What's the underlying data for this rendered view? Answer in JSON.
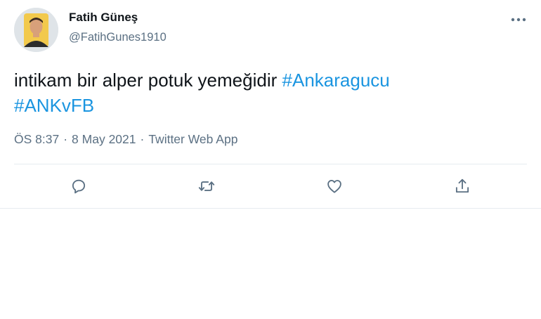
{
  "tweet": {
    "author_name": "Fatih Güneş",
    "author_handle": "@FatihGunes1910",
    "text": "intikam bir alper potuk yemeğidir",
    "hashtags": [
      "#Ankaragucu",
      "#ANKvFB"
    ],
    "time": "ÖS 8:37",
    "date": "8 May 2021",
    "source": "Twitter Web App",
    "separator": "·"
  },
  "icons": {
    "more": "more-horizontal-icon",
    "reply": "reply-icon",
    "retweet": "retweet-icon",
    "like": "heart-icon",
    "share": "share-icon"
  },
  "colors": {
    "hashtag": "#1b95e0",
    "secondary_text": "#5b7083",
    "icon": "#5b7083",
    "divider": "#e6ecf0"
  }
}
